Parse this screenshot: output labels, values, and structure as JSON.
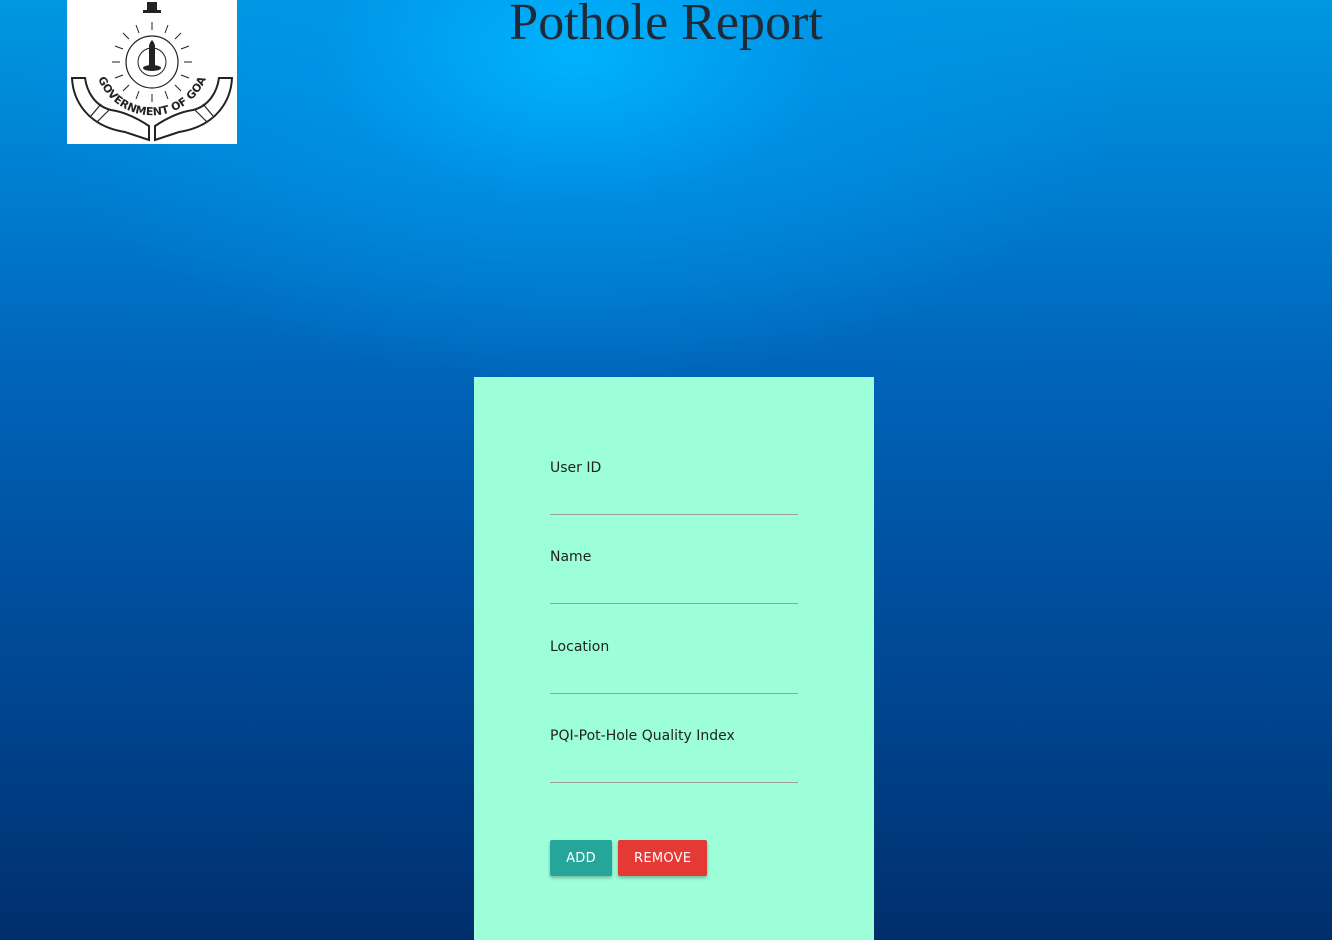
{
  "header": {
    "title": "Pothole Report",
    "logo_text": "GOVERNMENT OF GOA"
  },
  "form": {
    "fields": [
      {
        "label": "User ID",
        "value": ""
      },
      {
        "label": "Name",
        "value": ""
      },
      {
        "label": "Location",
        "value": ""
      },
      {
        "label": "PQI-Pot-Hole Quality Index",
        "value": ""
      }
    ],
    "add_label": "ADD",
    "remove_label": "REMOVE"
  },
  "colors": {
    "card_background": "#9cffd9",
    "add_button": "#26a69a",
    "remove_button": "#e53935"
  }
}
